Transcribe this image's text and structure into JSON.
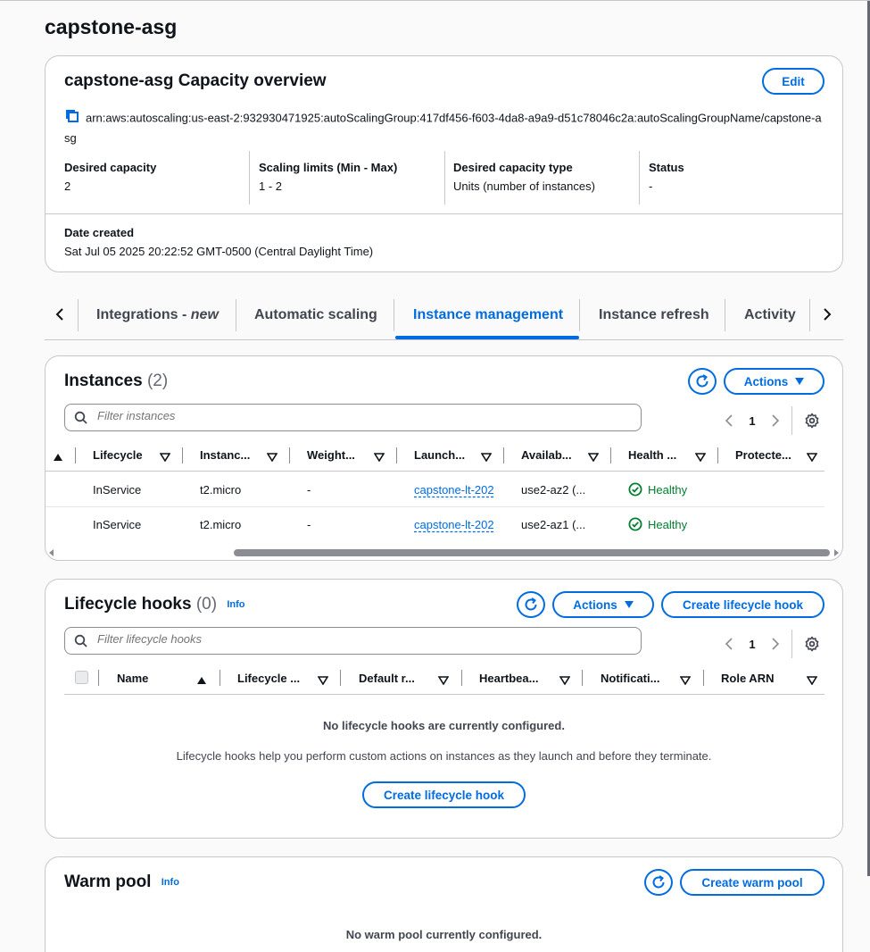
{
  "page_title": "capstone-asg",
  "overview": {
    "title": "capstone-asg Capacity overview",
    "edit_label": "Edit",
    "arn": "arn:aws:autoscaling:us-east-2:932930471925:autoScalingGroup:417df456-f603-4da8-a9a9-d51c78046c2a:autoScalingGroupName/capstone-asg",
    "desired_capacity_label": "Desired capacity",
    "desired_capacity_value": "2",
    "scaling_limits_label": "Scaling limits (Min - Max)",
    "scaling_limits_value": "1 - 2",
    "capacity_type_label": "Desired capacity type",
    "capacity_type_value": "Units (number of instances)",
    "status_label": "Status",
    "status_value": "-",
    "date_created_label": "Date created",
    "date_created_value": "Sat Jul 05 2025 20:22:52 GMT-0500 (Central Daylight Time)"
  },
  "tabs": {
    "integrations": "Integrations - ",
    "integrations_new": "new",
    "automatic_scaling": "Automatic scaling",
    "instance_management": "Instance management",
    "instance_refresh": "Instance refresh",
    "activity": "Activity",
    "active": "instance_management"
  },
  "instances": {
    "title": "Instances",
    "count": "(2)",
    "actions_label": "Actions",
    "filter_placeholder": "Filter instances",
    "page": "1",
    "columns": [
      "Lifecycle",
      "Instanc...",
      "Weight...",
      "Launch...",
      "Availab...",
      "Health ...",
      "Protecte..."
    ],
    "rows": [
      {
        "lifecycle": "InService",
        "type": "t2.micro",
        "weight": "-",
        "launch": "capstone-lt-202",
        "az": "use2-az2 (...",
        "health": "Healthy"
      },
      {
        "lifecycle": "InService",
        "type": "t2.micro",
        "weight": "-",
        "launch": "capstone-lt-202",
        "az": "use2-az1 (...",
        "health": "Healthy"
      }
    ]
  },
  "lifecycle_hooks": {
    "title": "Lifecycle hooks",
    "count": "(0)",
    "info": "Info",
    "actions_label": "Actions",
    "create_label": "Create lifecycle hook",
    "filter_placeholder": "Filter lifecycle hooks",
    "page": "1",
    "columns": [
      "Name",
      "Lifecycle ...",
      "Default r...",
      "Heartbea...",
      "Notificati...",
      "Role ARN"
    ],
    "empty_title": "No lifecycle hooks are currently configured.",
    "empty_desc": "Lifecycle hooks help you perform custom actions on instances as they launch and before they terminate.",
    "empty_create_label": "Create lifecycle hook"
  },
  "warm_pool": {
    "title": "Warm pool",
    "info": "Info",
    "create_label": "Create warm pool",
    "empty_title": "No warm pool currently configured."
  },
  "colors": {
    "accent": "#006ce0",
    "success": "#00802f",
    "border": "#c6c6cd"
  }
}
